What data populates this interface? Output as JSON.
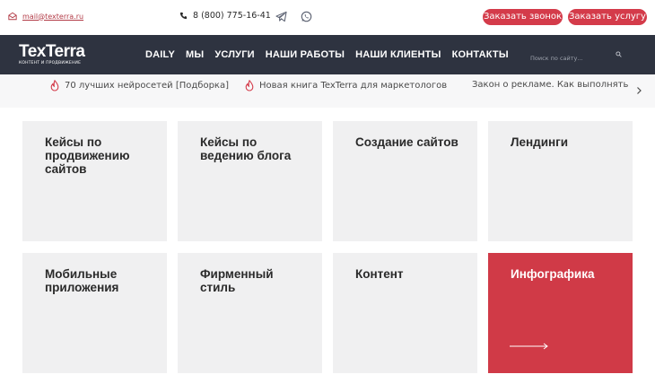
{
  "topbar": {
    "email": "mail@texterra.ru",
    "phone": "8 (800) 775-16-41",
    "call_button": "Заказать звонок",
    "order_button": "Заказать услугу"
  },
  "nav": {
    "logo_text": "TexTerra",
    "logo_sub": "КОНТЕНТ И ПРОДВИЖЕНИЕ",
    "items": [
      "DAILY",
      "МЫ",
      "УСЛУГИ",
      "НАШИ РАБОТЫ",
      "НАШИ КЛИЕНТЫ",
      "КОНТАКТЫ"
    ],
    "search_placeholder": "Поиск по сайту..."
  },
  "ticker": {
    "items": [
      "70 лучших нейросетей [Подборка]",
      "Новая книга TexTerra для маркетологов",
      "Закон о рекламе. Как выполнять"
    ]
  },
  "cards": [
    {
      "title": "Кейсы по продвижению сайтов"
    },
    {
      "title": "Кейсы по ведению блога"
    },
    {
      "title": "Создание сайтов"
    },
    {
      "title": "Лендинги"
    },
    {
      "title": "Мобильные приложения"
    },
    {
      "title": "Фирменный стиль"
    },
    {
      "title": "Контент"
    },
    {
      "title": "Инфографика"
    }
  ],
  "colors": {
    "brand_red": "#d43b4a",
    "nav_dark": "#2e3340",
    "card_bg": "#f0f0f1"
  }
}
